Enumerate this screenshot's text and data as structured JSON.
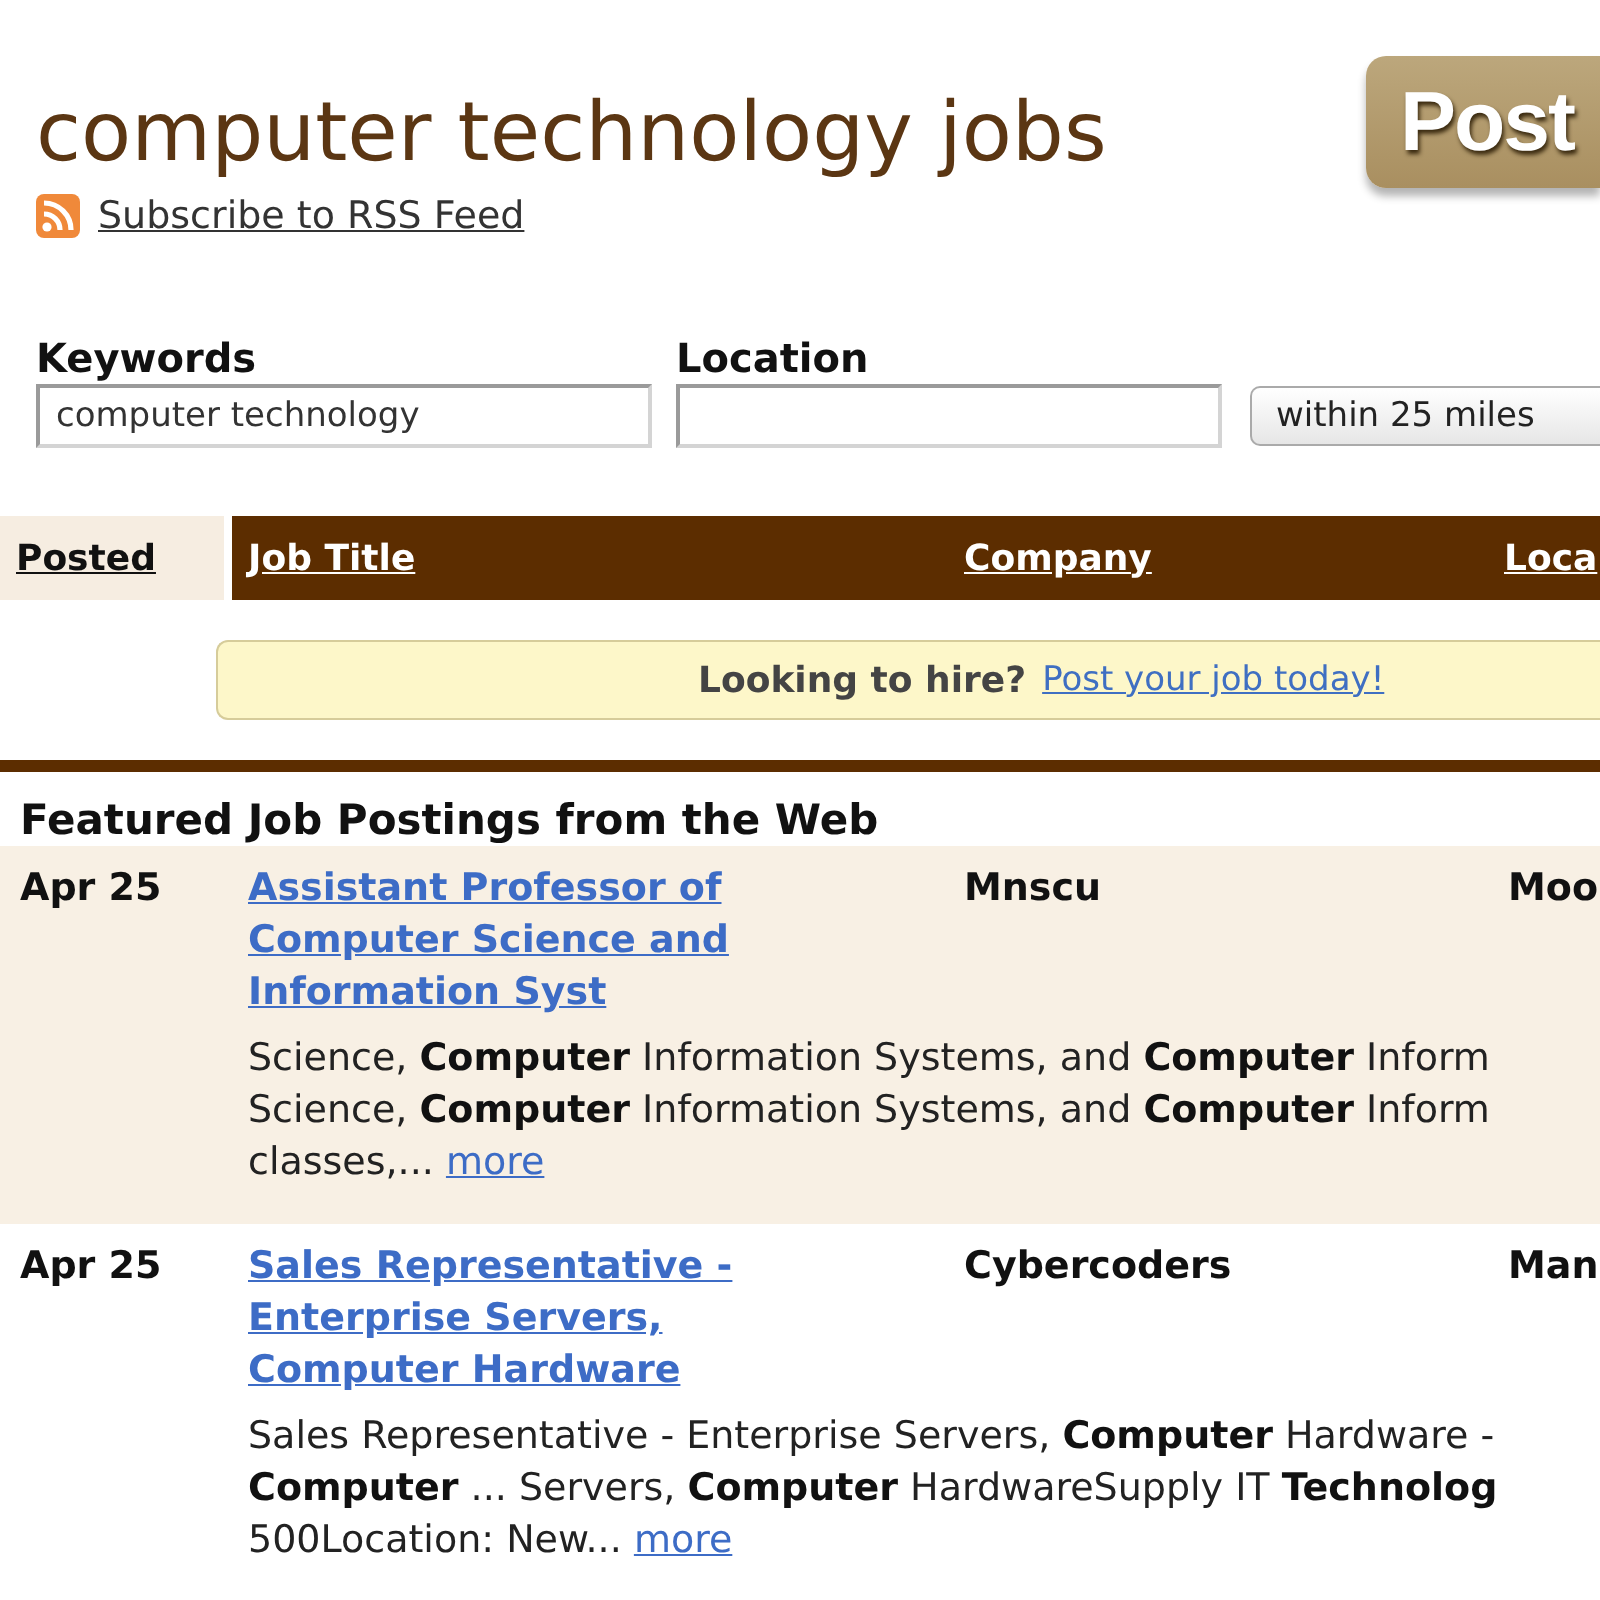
{
  "page": {
    "title": "computer technology jobs",
    "rss_link": "Subscribe to RSS Feed",
    "post_button": "Post"
  },
  "search": {
    "fields": [
      {
        "kind": "text",
        "label": "Keywords",
        "value": "computer technology"
      },
      {
        "kind": "text",
        "label": "Location"
      },
      {
        "kind": "select",
        "value": "within 25 miles"
      }
    ]
  },
  "table": {
    "columns": [
      {
        "label": "Posted",
        "selected": true
      },
      {
        "label": "Job Title",
        "selected": false
      },
      {
        "label": "Company",
        "selected": false
      },
      {
        "label": "Loca",
        "selected": false
      }
    ]
  },
  "hire_banner": {
    "text": "Looking to hire?",
    "link": "Post your job today!"
  },
  "featured": {
    "heading": "Featured Job Postings from the Web",
    "rows": [
      {
        "posted": "Apr 25",
        "title": "Assistant Professor of Computer Science and Information Syst",
        "company": "Mnscu",
        "location": "Moo",
        "snippet_lines": [
          "Science, **Computer** Information Systems, and **Computer** Inform",
          "Science, **Computer** Information Systems, and **Computer** Inform",
          "classes,..."
        ],
        "more": "more"
      },
      {
        "posted": "Apr 25",
        "title": "Sales Representative - Enterprise Servers, Computer Hardware",
        "company": "Cybercoders",
        "location": "Man",
        "snippet_lines": [
          "Sales Representative - Enterprise Servers, **Computer** Hardware -",
          "**Computer** ... Servers, **Computer** HardwareSupply IT **Technolog**",
          "500Location: New..."
        ],
        "more": "more"
      }
    ]
  }
}
